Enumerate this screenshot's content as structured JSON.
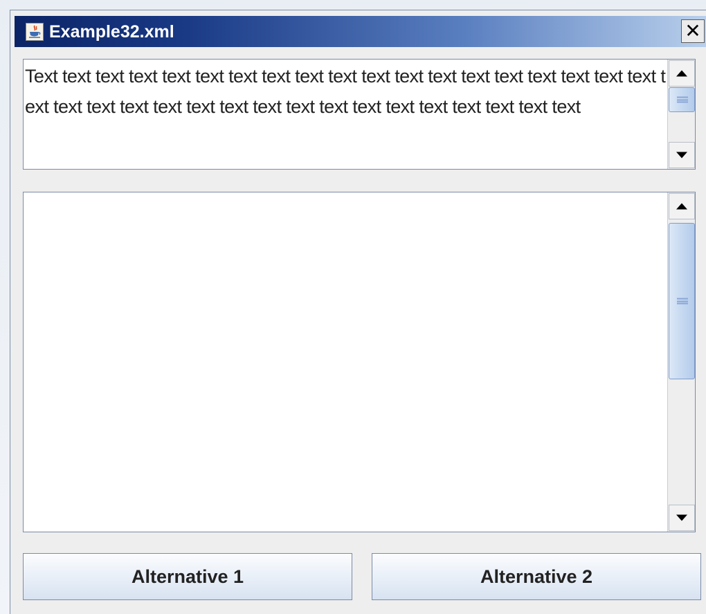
{
  "window": {
    "title": "Example32.xml",
    "close_glyph": "✕",
    "app_icon": "java-coffee-cup-icon"
  },
  "top_textarea": {
    "text": "Text text text text text text text text text text text text text text text text text text text text text text text text text text text text text text text text text text text text"
  },
  "bottom_textarea": {
    "text": ""
  },
  "buttons": {
    "alternative_1": "Alternative 1",
    "alternative_2": "Alternative 2"
  },
  "colors": {
    "titlebar_start": "#0b2466",
    "titlebar_end": "#b9d0ec",
    "window_bg": "#eeeeee",
    "scroll_thumb": "#c6d9f1"
  }
}
